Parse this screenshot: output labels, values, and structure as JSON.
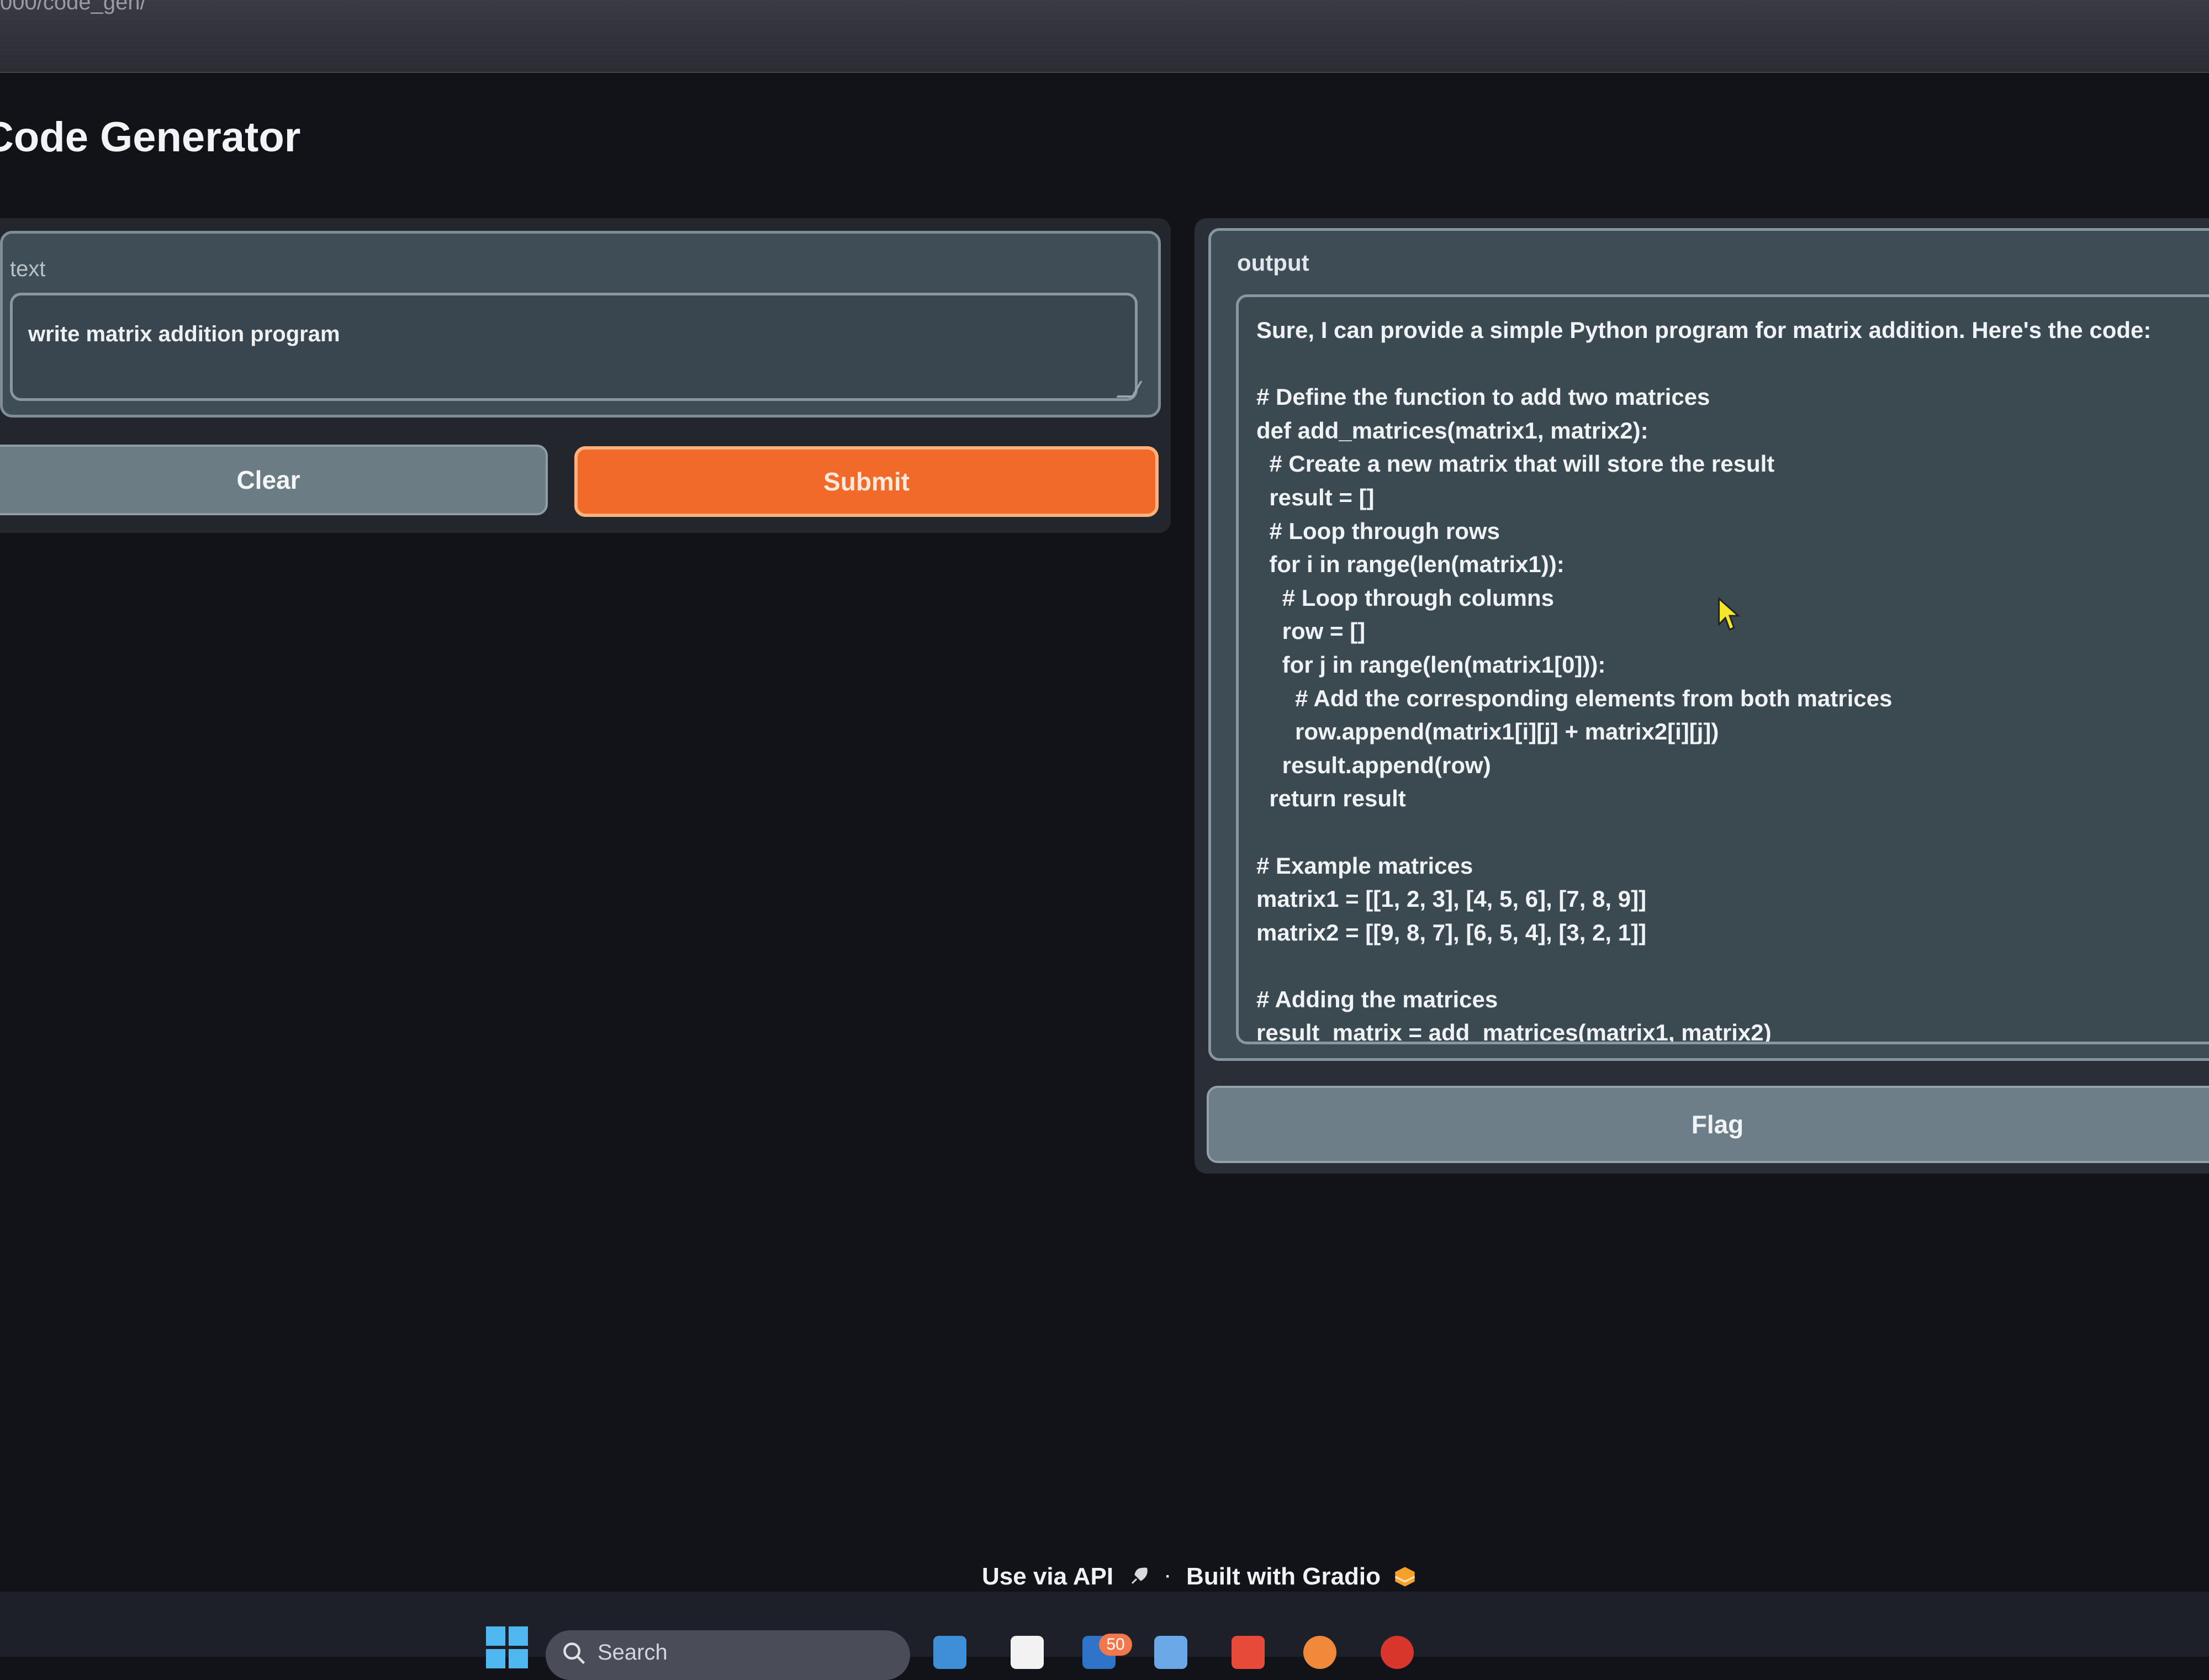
{
  "browser": {
    "url": "000/code_gen/"
  },
  "app": {
    "title": "Code Generator"
  },
  "input": {
    "label": "text",
    "value": "write matrix addition program"
  },
  "buttons": {
    "clear": "Clear",
    "submit": "Submit",
    "flag": "Flag"
  },
  "output": {
    "label": "output",
    "text": "Sure, I can provide a simple Python program for matrix addition. Here's the code:\n\n# Define the function to add two matrices\ndef add_matrices(matrix1, matrix2):\n  # Create a new matrix that will store the result\n  result = []\n  # Loop through rows\n  for i in range(len(matrix1)):\n    # Loop through columns\n    row = []\n    for j in range(len(matrix1[0])):\n      # Add the corresponding elements from both matrices\n      row.append(matrix1[i][j] + matrix2[i][j])\n    result.append(row)\n  return result\n\n# Example matrices\nmatrix1 = [[1, 2, 3], [4, 5, 6], [7, 8, 9]]\nmatrix2 = [[9, 8, 7], [6, 5, 4], [3, 2, 1]]\n\n# Adding the matrices\nresult_matrix = add_matrices(matrix1, matrix2)"
  },
  "footer": {
    "api": "Use via API",
    "separator": "·",
    "built": "Built with Gradio"
  },
  "taskbar": {
    "search_label": "Search",
    "badge_count": "50"
  },
  "colors": {
    "accent": "#f26a2a",
    "background": "#121219",
    "panel": "#3e4c55"
  }
}
